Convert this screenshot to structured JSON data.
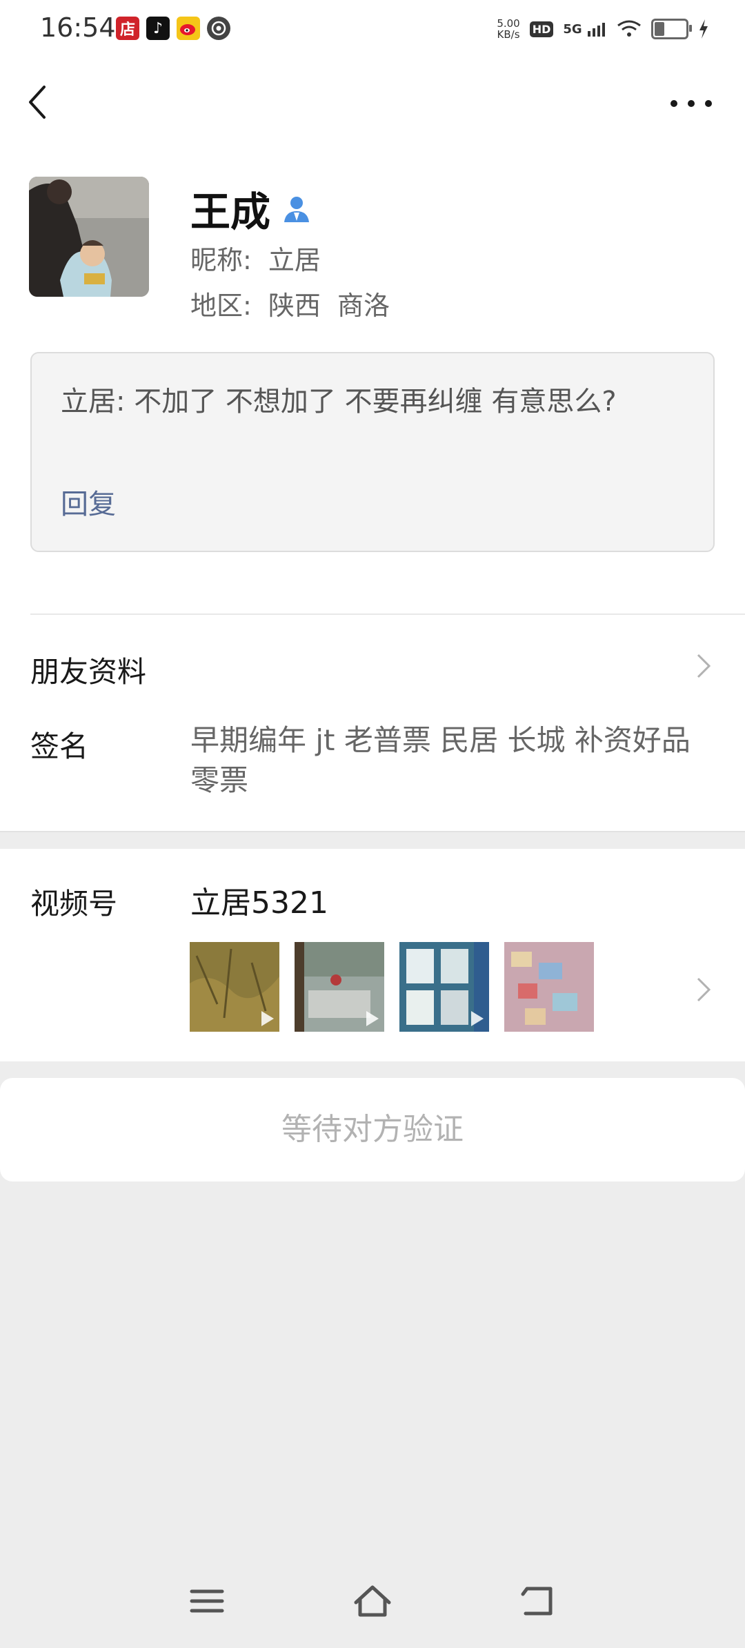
{
  "status_bar": {
    "time": "16:54",
    "net_speed_value": "5.00",
    "net_speed_unit": "KB/s",
    "hd": "HD",
    "network": "5G",
    "app_icons": [
      "shop-icon",
      "tiktok-icon",
      "weibo-icon",
      "camera-icon"
    ],
    "app_icon_glyphs": [
      "店",
      "♪",
      "",
      ""
    ]
  },
  "profile": {
    "name": "王成",
    "nickname_label": "昵称:",
    "nickname": "立居",
    "region_label": "地区:",
    "region": "陕西  商洛"
  },
  "greeting": {
    "text": "立居: 不加了 不想加了 不要再纠缠 有意思么?",
    "reply": "回复"
  },
  "rows": {
    "friend_info": "朋友资料",
    "signature_label": "签名",
    "signature": "早期编年 jt  老普票 民居 长城 补资好品零票"
  },
  "channels": {
    "label": "视频号",
    "name": "立居5321"
  },
  "action": {
    "label": "等待对方验证"
  },
  "colors": {
    "link": "#576b95",
    "background": "#ededed",
    "badge_blue": "#4a90e2"
  }
}
